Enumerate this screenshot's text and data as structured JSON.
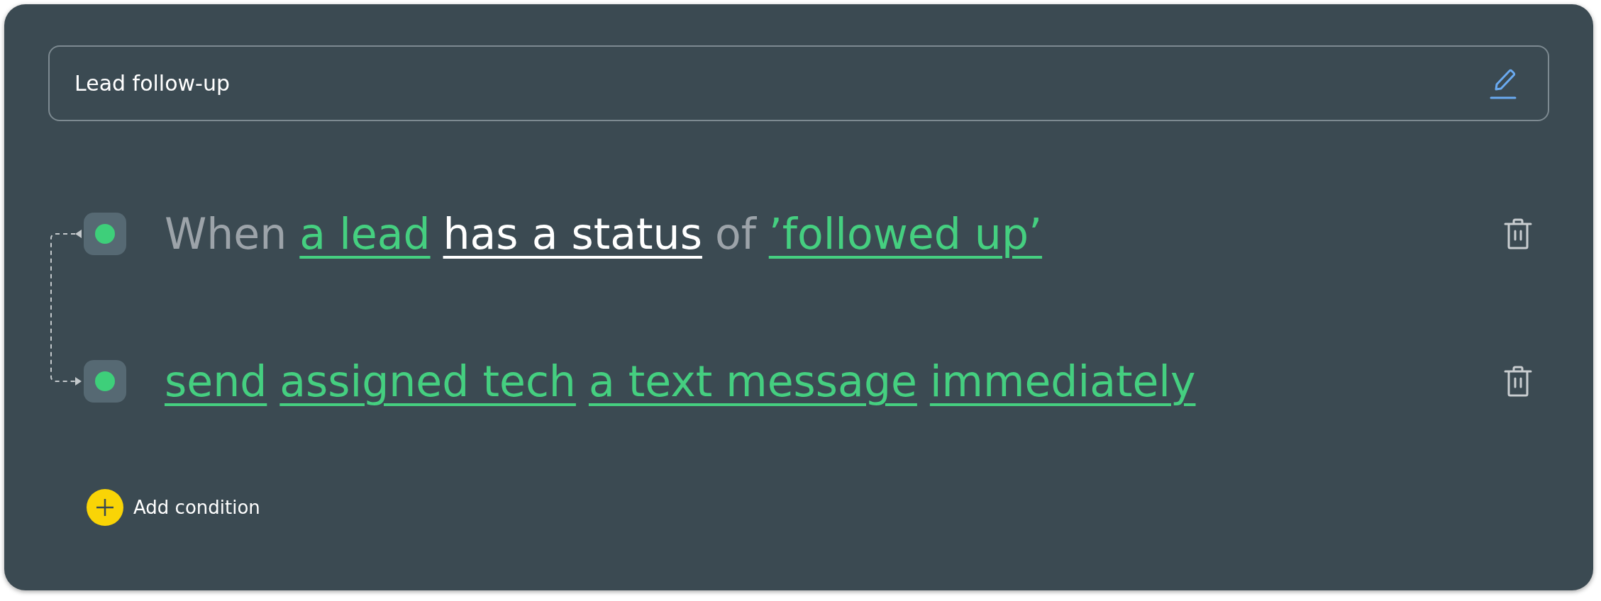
{
  "title_field": {
    "value": "Lead follow-up"
  },
  "rules": [
    {
      "segments": [
        {
          "kind": "plain",
          "text": "When"
        },
        {
          "kind": "link",
          "text": "a lead"
        },
        {
          "kind": "field",
          "text": "has a status"
        },
        {
          "kind": "plain",
          "text": "of"
        },
        {
          "kind": "link",
          "text": "’followed up’"
        }
      ]
    },
    {
      "segments": [
        {
          "kind": "link",
          "text": "send"
        },
        {
          "kind": "link",
          "text": "assigned tech"
        },
        {
          "kind": "link",
          "text": "a text message"
        },
        {
          "kind": "link",
          "text": "immediately"
        }
      ]
    }
  ],
  "add_button": {
    "label": "Add condition"
  }
}
